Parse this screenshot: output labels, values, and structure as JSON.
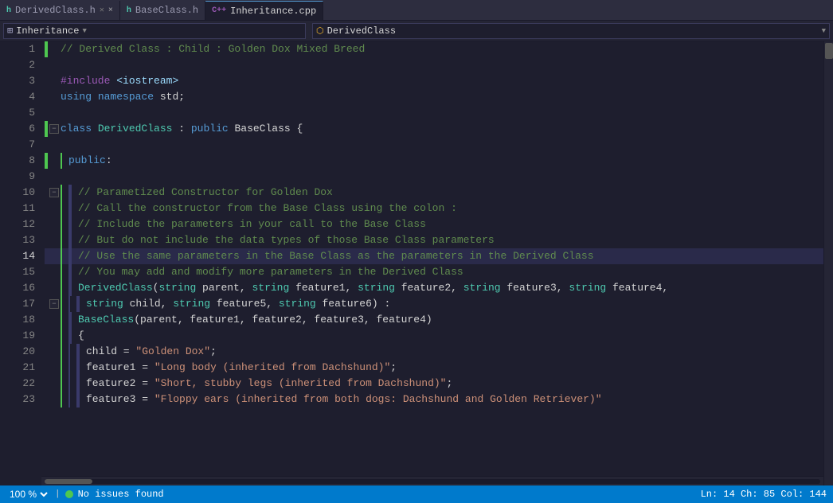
{
  "tabs": [
    {
      "id": "derived",
      "label": "DerivedClass.h",
      "icon": "h",
      "active": false,
      "modified": true
    },
    {
      "id": "base",
      "label": "BaseClass.h",
      "icon": "h",
      "active": false,
      "modified": false
    },
    {
      "id": "inheritance",
      "label": "Inheritance.cpp",
      "icon": "cpp",
      "active": true,
      "modified": false
    }
  ],
  "toolbar": {
    "left_icon": "puzzle",
    "left_text": "Inheritance",
    "dropdown_icon": "class",
    "dropdown_text": "DerivedClass",
    "dropdown_arrow": "▼"
  },
  "lines": [
    {
      "num": 1,
      "indent": 0,
      "green": true,
      "collapse": false,
      "tokens": [
        {
          "t": "comment",
          "v": "// Derived Class : Child : Golden Dox Mixed Breed"
        }
      ]
    },
    {
      "num": 2,
      "indent": 0,
      "green": false,
      "collapse": false,
      "tokens": []
    },
    {
      "num": 3,
      "indent": 0,
      "green": false,
      "collapse": false,
      "tokens": [
        {
          "t": "preprocessor",
          "v": "#include"
        },
        {
          "t": "default",
          "v": " "
        },
        {
          "t": "include",
          "v": "<iostream>"
        }
      ]
    },
    {
      "num": 4,
      "indent": 0,
      "green": false,
      "collapse": false,
      "tokens": [
        {
          "t": "keyword",
          "v": "using"
        },
        {
          "t": "default",
          "v": " "
        },
        {
          "t": "keyword",
          "v": "namespace"
        },
        {
          "t": "default",
          "v": " std;"
        }
      ]
    },
    {
      "num": 5,
      "indent": 0,
      "green": false,
      "collapse": false,
      "tokens": []
    },
    {
      "num": 6,
      "indent": 0,
      "green": true,
      "collapse": true,
      "tokens": [
        {
          "t": "keyword",
          "v": "class"
        },
        {
          "t": "default",
          "v": " "
        },
        {
          "t": "typename",
          "v": "DerivedClass"
        },
        {
          "t": "default",
          "v": " : "
        },
        {
          "t": "keyword",
          "v": "public"
        },
        {
          "t": "default",
          "v": " BaseClass {"
        }
      ]
    },
    {
      "num": 7,
      "indent": 0,
      "green": false,
      "collapse": false,
      "tokens": []
    },
    {
      "num": 8,
      "indent": 1,
      "green": true,
      "collapse": false,
      "tokens": [
        {
          "t": "keyword",
          "v": "public"
        },
        {
          "t": "default",
          "v": ":"
        }
      ]
    },
    {
      "num": 9,
      "indent": 0,
      "green": false,
      "collapse": false,
      "tokens": []
    },
    {
      "num": 10,
      "indent": 2,
      "green": false,
      "collapse": true,
      "tokens": [
        {
          "t": "comment",
          "v": "// Parametized Constructor for Golden Dox"
        }
      ]
    },
    {
      "num": 11,
      "indent": 2,
      "green": false,
      "collapse": false,
      "tokens": [
        {
          "t": "comment",
          "v": "// Call the constructor from the Base Class using the colon :"
        }
      ]
    },
    {
      "num": 12,
      "indent": 2,
      "green": false,
      "collapse": false,
      "tokens": [
        {
          "t": "comment",
          "v": "// Include the parameters in your call to the Base Class"
        }
      ]
    },
    {
      "num": 13,
      "indent": 2,
      "green": false,
      "collapse": false,
      "tokens": [
        {
          "t": "comment",
          "v": "// But do not include the data types of those Base Class parameters"
        }
      ]
    },
    {
      "num": 14,
      "indent": 2,
      "green": false,
      "collapse": false,
      "tokens": [
        {
          "t": "comment",
          "v": "// Use the same parameters in the Base Class as the parameters in the Derived Class"
        }
      ],
      "highlighted": true
    },
    {
      "num": 15,
      "indent": 2,
      "green": false,
      "collapse": false,
      "tokens": [
        {
          "t": "comment",
          "v": "// You may add and modify more parameters in the Derived Class"
        }
      ]
    },
    {
      "num": 16,
      "indent": 2,
      "green": false,
      "collapse": false,
      "tokens": [
        {
          "t": "typename",
          "v": "DerivedClass"
        },
        {
          "t": "default",
          "v": "("
        },
        {
          "t": "teal",
          "v": "string"
        },
        {
          "t": "default",
          "v": " parent, "
        },
        {
          "t": "teal",
          "v": "string"
        },
        {
          "t": "default",
          "v": " feature1, "
        },
        {
          "t": "teal",
          "v": "string"
        },
        {
          "t": "default",
          "v": " feature2, "
        },
        {
          "t": "teal",
          "v": "string"
        },
        {
          "t": "default",
          "v": " feature3, "
        },
        {
          "t": "teal",
          "v": "string"
        },
        {
          "t": "default",
          "v": " feature4,"
        }
      ]
    },
    {
      "num": 17,
      "indent": 3,
      "green": false,
      "collapse": true,
      "tokens": [
        {
          "t": "teal",
          "v": "string"
        },
        {
          "t": "default",
          "v": " child, "
        },
        {
          "t": "teal",
          "v": "string"
        },
        {
          "t": "default",
          "v": " feature5, "
        },
        {
          "t": "teal",
          "v": "string"
        },
        {
          "t": "default",
          "v": " feature6) :"
        }
      ]
    },
    {
      "num": 18,
      "indent": 2,
      "green": false,
      "collapse": false,
      "tokens": [
        {
          "t": "typename",
          "v": "BaseClass"
        },
        {
          "t": "default",
          "v": "(parent, feature1, feature2, feature3, feature4)"
        }
      ]
    },
    {
      "num": 19,
      "indent": 2,
      "green": false,
      "collapse": false,
      "tokens": [
        {
          "t": "default",
          "v": "{"
        }
      ]
    },
    {
      "num": 20,
      "indent": 3,
      "green": false,
      "collapse": false,
      "tokens": [
        {
          "t": "default",
          "v": "child = "
        },
        {
          "t": "string",
          "v": "\"Golden Dox\""
        },
        {
          "t": "default",
          "v": ";"
        }
      ]
    },
    {
      "num": 21,
      "indent": 3,
      "green": false,
      "collapse": false,
      "tokens": [
        {
          "t": "default",
          "v": "feature1 = "
        },
        {
          "t": "string",
          "v": "\"Long body (inherited from Dachshund)\""
        },
        {
          "t": "default",
          "v": ";"
        }
      ]
    },
    {
      "num": 22,
      "indent": 3,
      "green": false,
      "collapse": false,
      "tokens": [
        {
          "t": "default",
          "v": "feature2 = "
        },
        {
          "t": "string",
          "v": "\"Short, stubby legs (inherited from Dachshund)\""
        },
        {
          "t": "default",
          "v": ";"
        }
      ]
    },
    {
      "num": 23,
      "indent": 3,
      "green": false,
      "collapse": false,
      "tokens": [
        {
          "t": "default",
          "v": "feature3 = "
        },
        {
          "t": "string",
          "v": "\"Floppy ears (inherited from both dogs: Dachshund and Golden Retriever)\""
        }
      ]
    }
  ],
  "status": {
    "zoom": "100 %",
    "indicator_text": "No issues found",
    "position": "Ln: 14  Ch: 85  Col: 144"
  }
}
